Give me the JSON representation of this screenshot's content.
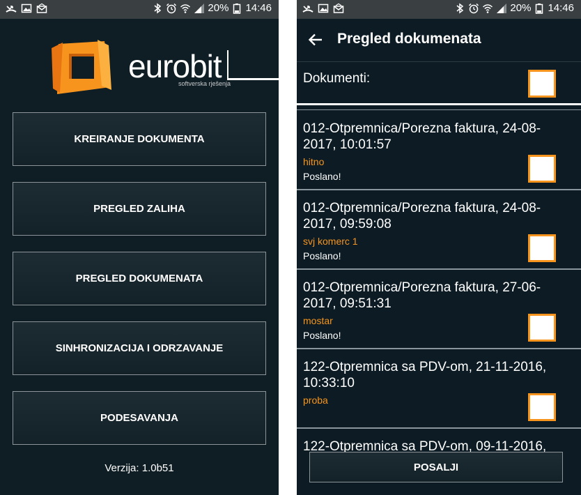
{
  "left": {
    "status": {
      "battery": "20%",
      "time": "14:46"
    },
    "logo": {
      "word": "eurobit",
      "tagline": "softverska rješenja"
    },
    "menu": [
      {
        "label": "KREIRANJE DOKUMENTA"
      },
      {
        "label": "PREGLED ZALIHA"
      },
      {
        "label": "PREGLED DOKUMENATA"
      },
      {
        "label": "SINHRONIZACIJA I ODRZAVANJE"
      },
      {
        "label": "PODESAVANJA"
      }
    ],
    "version": "Verzija: 1.0b51"
  },
  "right": {
    "status": {
      "battery": "20%",
      "time": "14:46"
    },
    "title": "Pregled dokumenata",
    "header_label": "Dokumenti:",
    "documents": [
      {
        "title": "012-Otpremnica/Porezna faktura, 24-08-2017, 10:01:57",
        "customer": "hitno",
        "status": "Poslano!"
      },
      {
        "title": "012-Otpremnica/Porezna faktura, 24-08-2017, 09:59:08",
        "customer": "svj komerc 1",
        "status": "Poslano!"
      },
      {
        "title": "012-Otpremnica/Porezna faktura, 27-06-2017, 09:51:31",
        "customer": "mostar",
        "status": "Poslano!"
      },
      {
        "title": "122-Otpremnica sa PDV-om, 21-11-2016, 10:33:10",
        "customer": "proba",
        "status": ""
      },
      {
        "title": "122-Otpremnica sa PDV-om, 09-11-2016,",
        "customer": "",
        "status": ""
      }
    ],
    "send_label": "POSALJI"
  },
  "colors": {
    "background": "#0f1e25",
    "accent": "#f7941d",
    "statusbar": "#3a3f42"
  },
  "icons": [
    "missed-call-icon",
    "image-icon",
    "email-icon",
    "bluetooth-icon",
    "alarm-icon",
    "wifi-icon",
    "signal-icon",
    "battery-icon",
    "back-arrow-icon",
    "eurobit-logo-icon"
  ]
}
